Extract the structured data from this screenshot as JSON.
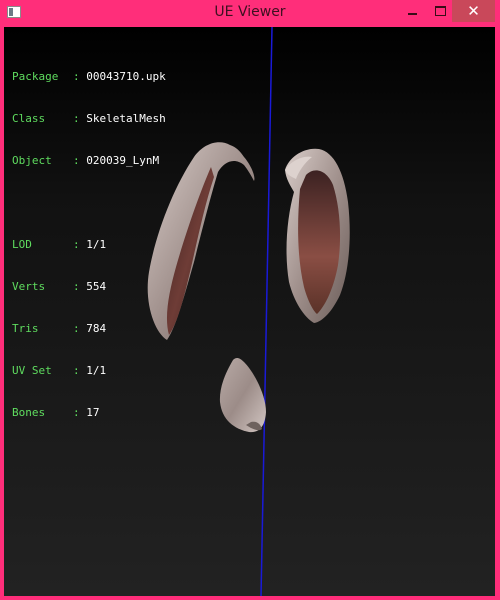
{
  "window": {
    "title": "UE Viewer",
    "icon": "app-window-icon",
    "controls": {
      "minimize_icon": "minimize-icon",
      "maximize_icon": "maximize-icon",
      "close_label": "✕"
    }
  },
  "info": {
    "package": {
      "key": "Package",
      "value": "00043710.upk"
    },
    "class": {
      "key": "Class",
      "value": "SkeletalMesh"
    },
    "object": {
      "key": "Object",
      "value": "020039_LynM"
    },
    "lod": {
      "key": "LOD",
      "value": "1/1"
    },
    "verts": {
      "key": "Verts",
      "value": "554"
    },
    "tris": {
      "key": "Tris",
      "value": "784"
    },
    "uvset": {
      "key": "UV Set",
      "value": "1/1"
    },
    "bones": {
      "key": "Bones",
      "value": "17"
    }
  },
  "colors": {
    "frame": "#ff2e7a",
    "label_green": "#5fdc5f",
    "axis_blue": "#1a1ad8"
  }
}
